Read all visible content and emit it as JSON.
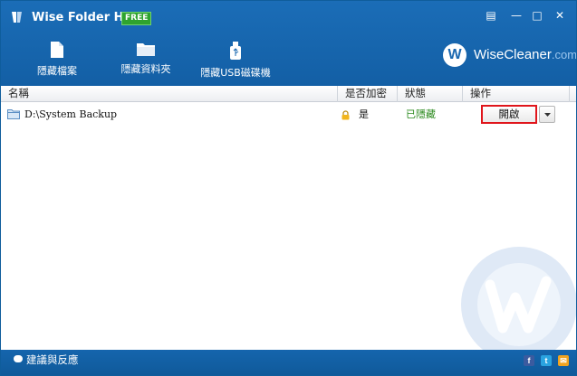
{
  "app": {
    "title": "Wise Folder Hider",
    "badge": "FREE"
  },
  "window_controls": [
    {
      "icon": "menu-icon",
      "glyph": "▤"
    },
    {
      "icon": "minimize-icon",
      "glyph": "—"
    },
    {
      "icon": "maximize-icon",
      "glyph": "□"
    },
    {
      "icon": "close-icon",
      "glyph": "✕"
    }
  ],
  "toolbar": {
    "hide_file": "隱藏檔案",
    "hide_folder": "隱藏資料夾",
    "hide_usb": "隱藏USB磁碟機"
  },
  "brand": {
    "logo_letter": "W",
    "name": "WiseCleaner",
    "suffix": ".com"
  },
  "table": {
    "headers": {
      "name": "名稱",
      "encrypted": "是否加密",
      "status": "狀態",
      "action": "操作"
    },
    "rows": [
      {
        "path": "D:\\System Backup",
        "encrypted": "是",
        "status": "已隱藏",
        "action": "開啟"
      }
    ]
  },
  "footer": {
    "feedback": "建議與反應",
    "social": [
      "f",
      "t",
      "✉"
    ]
  },
  "colors": {
    "header_blue": "#1b6db7",
    "status_green": "#2b8a1e",
    "highlight_red": "#e0151b",
    "free_green": "#2fa32f"
  }
}
